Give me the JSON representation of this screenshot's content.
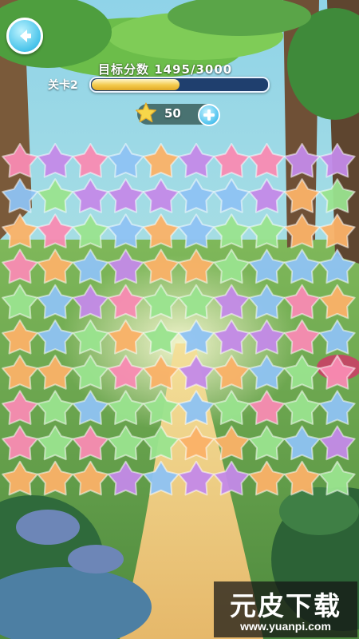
{
  "hud": {
    "target_label": "目标分数 1495/3000",
    "level_label": "关卡2",
    "score_progress": 0.498,
    "coins": "50"
  },
  "icons": {
    "back": "back-arrow-icon",
    "coin": "star-coin-icon",
    "add": "plus-icon"
  },
  "palette": {
    "p": "#f98bb3",
    "u": "#c48ae9",
    "b": "#8fc3f4",
    "o": "#fbb268",
    "g": "#9ae48f"
  },
  "board": {
    "rows": [
      "pupbouppuu",
      "bguuubbuog",
      "opgbobggoo",
      "pobuoogbbb",
      "gbupggubpo",
      "obgogbuupb",
      "oogpouobgp",
      "pgbggbgpgb",
      "pgpggoogbu",
      "oooubuuoog"
    ]
  },
  "watermark": {
    "title": "元皮下载",
    "url": "www.yuanpi.com"
  }
}
